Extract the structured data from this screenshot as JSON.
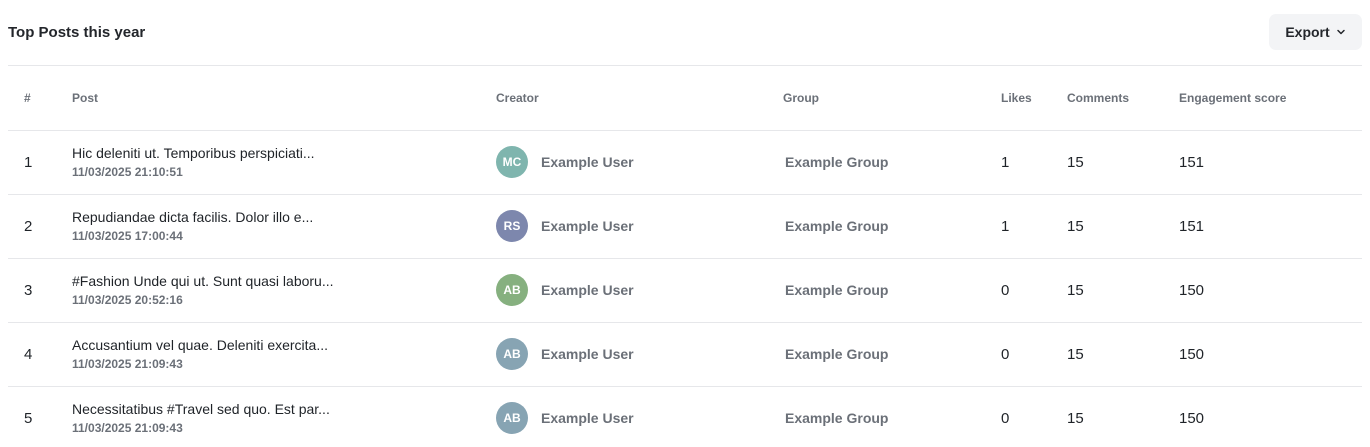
{
  "header": {
    "title": "Top Posts this year",
    "export_label": "Export",
    "export_icon": "chevron-down-icon"
  },
  "table": {
    "columns": {
      "rank": "#",
      "post": "Post",
      "creator": "Creator",
      "group": "Group",
      "likes": "Likes",
      "comments": "Comments",
      "score": "Engagement score"
    },
    "rows": [
      {
        "rank": "1",
        "title": "Hic deleniti ut. Temporibus perspiciati...",
        "date": "11/03/2025 21:10:51",
        "initials": "MC",
        "avatar_color": "#7fb5ae",
        "creator": "Example User",
        "group": "Example Group",
        "likes": "1",
        "comments": "15",
        "score": "151"
      },
      {
        "rank": "2",
        "title": "Repudiandae dicta facilis. Dolor illo e...",
        "date": "11/03/2025 17:00:44",
        "initials": "RS",
        "avatar_color": "#7d87ad",
        "creator": "Example User",
        "group": "Example Group",
        "likes": "1",
        "comments": "15",
        "score": "151"
      },
      {
        "rank": "3",
        "title": "#Fashion Unde qui ut. Sunt quasi laboru...",
        "date": "11/03/2025 20:52:16",
        "initials": "AB",
        "avatar_color": "#86b07f",
        "creator": "Example User",
        "group": "Example Group",
        "likes": "0",
        "comments": "15",
        "score": "150"
      },
      {
        "rank": "4",
        "title": "Accusantium vel quae. Deleniti exercita...",
        "date": "11/03/2025 21:09:43",
        "initials": "AB",
        "avatar_color": "#87a4b3",
        "creator": "Example User",
        "group": "Example Group",
        "likes": "0",
        "comments": "15",
        "score": "150"
      },
      {
        "rank": "5",
        "title": "Necessitatibus #Travel sed quo. Est par...",
        "date": "11/03/2025 21:09:43",
        "initials": "AB",
        "avatar_color": "#87a4b3",
        "creator": "Example User",
        "group": "Example Group",
        "likes": "0",
        "comments": "15",
        "score": "150"
      }
    ]
  }
}
